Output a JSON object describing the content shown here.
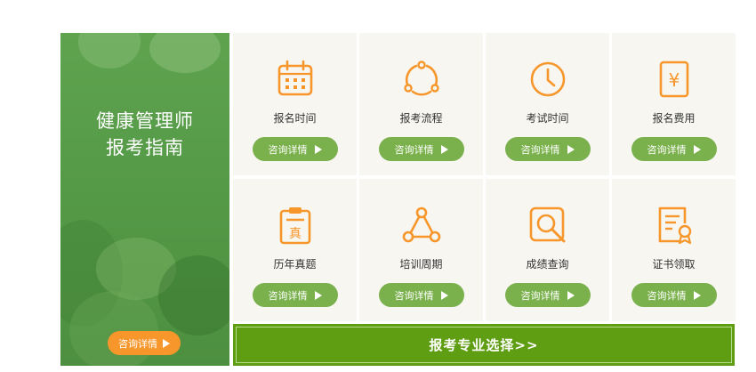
{
  "left": {
    "title_line1": "健康管理师",
    "title_line2": "报考指南",
    "button_label": "咨询详情"
  },
  "cells": [
    {
      "label": "报名时间",
      "icon": "calendar-icon",
      "button": "咨询详情"
    },
    {
      "label": "报考流程",
      "icon": "cycle-icon",
      "button": "咨询详情"
    },
    {
      "label": "考试时间",
      "icon": "clock-icon",
      "button": "咨询详情"
    },
    {
      "label": "报名费用",
      "icon": "yuan-icon",
      "button": "咨询详情"
    },
    {
      "label": "历年真题",
      "icon": "clipboard-icon",
      "button": "咨询详情"
    },
    {
      "label": "培训周期",
      "icon": "network-icon",
      "button": "咨询详情"
    },
    {
      "label": "成绩查询",
      "icon": "search-icon",
      "button": "咨询详情"
    },
    {
      "label": "证书领取",
      "icon": "certificate-icon",
      "button": "咨询详情"
    }
  ],
  "clipboard_char": "真",
  "yuan_char": "¥",
  "bottom": {
    "label": "报考专业选择>>"
  },
  "colors": {
    "accent_orange": "#f7962b",
    "button_green": "#7bb14d",
    "bar_green": "#5f9e12",
    "panel_green": "#5fa34f"
  }
}
